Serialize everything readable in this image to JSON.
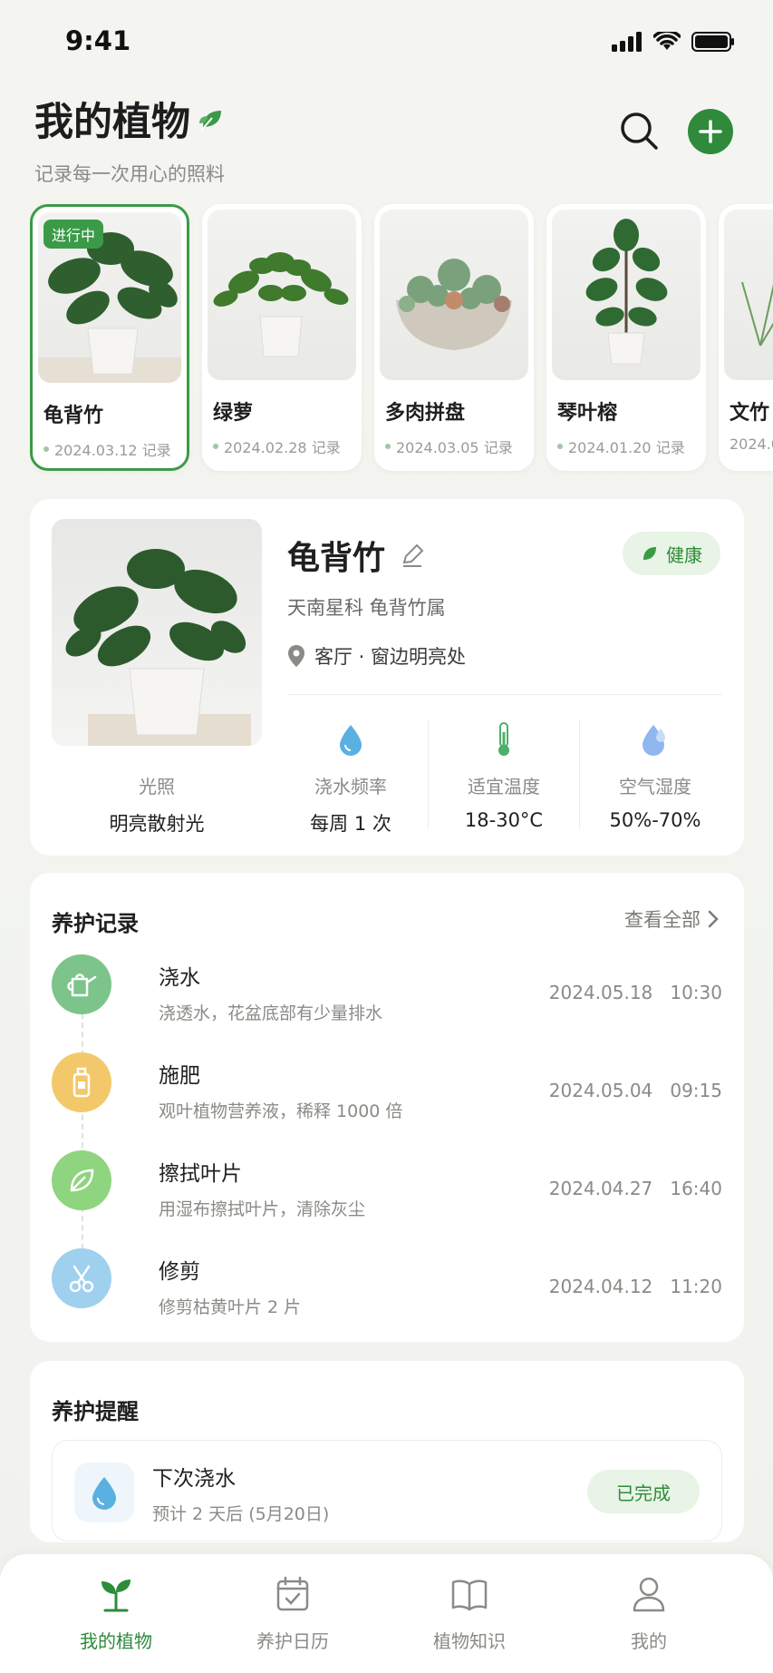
{
  "status_bar": {
    "time": "9:41"
  },
  "header": {
    "title": "我的植物",
    "subtitle": "记录每一次用心的照料"
  },
  "plants": [
    {
      "name": "龟背竹",
      "date": "2024.03.12 记录",
      "badge": "进行中"
    },
    {
      "name": "绿萝",
      "date": "2024.02.28 记录"
    },
    {
      "name": "多肉拼盘",
      "date": "2024.03.05 记录"
    },
    {
      "name": "琴叶榕",
      "date": "2024.01.20 记录"
    },
    {
      "name": "文竹",
      "date": "2024.0"
    }
  ],
  "detail": {
    "name": "龟背竹",
    "health": "健康",
    "family": "天南星科 龟背竹属",
    "location": "客厅 · 窗边明亮处",
    "stats": [
      {
        "label": "光照",
        "value": "明亮散射光"
      },
      {
        "label": "浇水频率",
        "value": "每周 1 次"
      },
      {
        "label": "适宜温度",
        "value": "18-30°C"
      },
      {
        "label": "空气湿度",
        "value": "50%-70%"
      }
    ]
  },
  "records": {
    "title": "养护记录",
    "view_all": "查看全部",
    "items": [
      {
        "title": "浇水",
        "desc": "浇透水，花盆底部有少量排水",
        "date": "2024.05.18",
        "time": "10:30",
        "color": "#7cc48a",
        "icon": "watering-can-icon"
      },
      {
        "title": "施肥",
        "desc": "观叶植物营养液，稀释 1000 倍",
        "date": "2024.05.04",
        "time": "09:15",
        "color": "#f2c86a",
        "icon": "fertilizer-bottle-icon"
      },
      {
        "title": "擦拭叶片",
        "desc": "用湿布擦拭叶片，清除灰尘",
        "date": "2024.04.27",
        "time": "16:40",
        "color": "#8fd47e",
        "icon": "leaf-icon"
      },
      {
        "title": "修剪",
        "desc": "修剪枯黄叶片 2 片",
        "date": "2024.04.12",
        "time": "11:20",
        "color": "#9fd0ee",
        "icon": "scissors-icon"
      }
    ]
  },
  "reminder": {
    "title": "养护提醒",
    "item_title": "下次浇水",
    "item_desc": "预计 2 天后 (5月20日)",
    "button": "已完成"
  },
  "tabs": [
    {
      "label": "我的植物",
      "active": true
    },
    {
      "label": "养护日历"
    },
    {
      "label": "植物知识"
    },
    {
      "label": "我的"
    }
  ],
  "colors": {
    "accent": "#2f8a3c",
    "background": "#f3f4f0"
  }
}
